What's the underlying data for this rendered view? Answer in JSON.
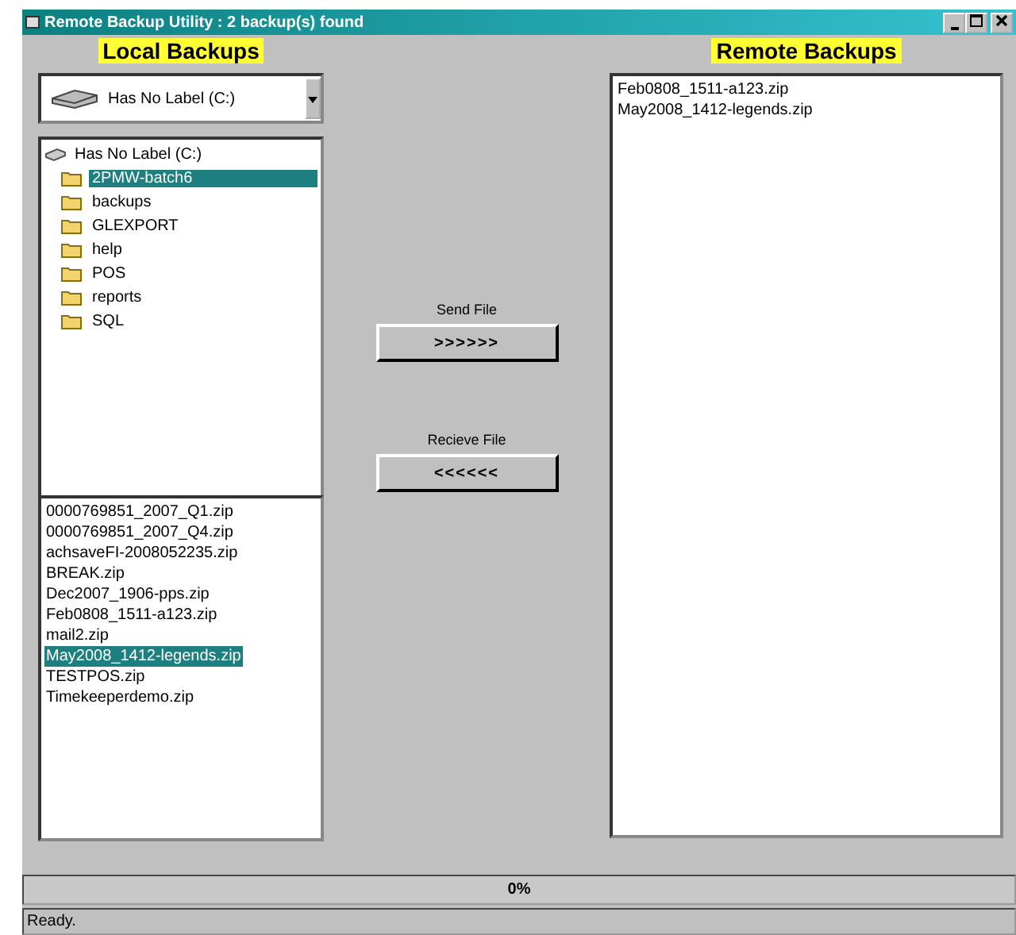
{
  "window": {
    "title": "Remote Backup Utility : 2 backup(s) found"
  },
  "local": {
    "heading": "Local Backups",
    "drive": "Has No Label (C:)",
    "tree": [
      {
        "label": "Has No Label (C:)",
        "kind": "drive",
        "selected": false,
        "children": [
          {
            "label": "2PMW-batch6",
            "kind": "folder",
            "selected": true
          },
          {
            "label": "backups",
            "kind": "folder",
            "selected": false
          },
          {
            "label": "GLEXPORT",
            "kind": "folder",
            "selected": false
          },
          {
            "label": "help",
            "kind": "folder",
            "selected": false
          },
          {
            "label": "POS",
            "kind": "folder",
            "selected": false
          },
          {
            "label": "reports",
            "kind": "folder",
            "selected": false
          },
          {
            "label": "SQL",
            "kind": "folder",
            "selected": false
          }
        ]
      }
    ],
    "files": [
      {
        "name": "0000769851_2007_Q1.zip",
        "selected": false
      },
      {
        "name": "0000769851_2007_Q4.zip",
        "selected": false
      },
      {
        "name": "achsaveFI-2008052235.zip",
        "selected": false
      },
      {
        "name": "BREAK.zip",
        "selected": false
      },
      {
        "name": "Dec2007_1906-pps.zip",
        "selected": false
      },
      {
        "name": "Feb0808_1511-a123.zip",
        "selected": false
      },
      {
        "name": "mail2.zip",
        "selected": false
      },
      {
        "name": "May2008_1412-legends.zip",
        "selected": true
      },
      {
        "name": "TESTPOS.zip",
        "selected": false
      },
      {
        "name": "Timekeeperdemo.zip",
        "selected": false
      }
    ]
  },
  "transfer": [
    {
      "label": "Send File",
      "button": ">>>>>>"
    },
    {
      "label": "Recieve File",
      "button": "<<<<<<"
    }
  ],
  "remote": {
    "heading": "Remote Backups",
    "files": [
      {
        "name": "Feb0808_1511-a123.zip",
        "selected": false
      },
      {
        "name": "May2008_1412-legends.zip",
        "selected": false
      }
    ]
  },
  "progress": {
    "text": "0%",
    "level": 0
  },
  "status_bar": "Ready."
}
